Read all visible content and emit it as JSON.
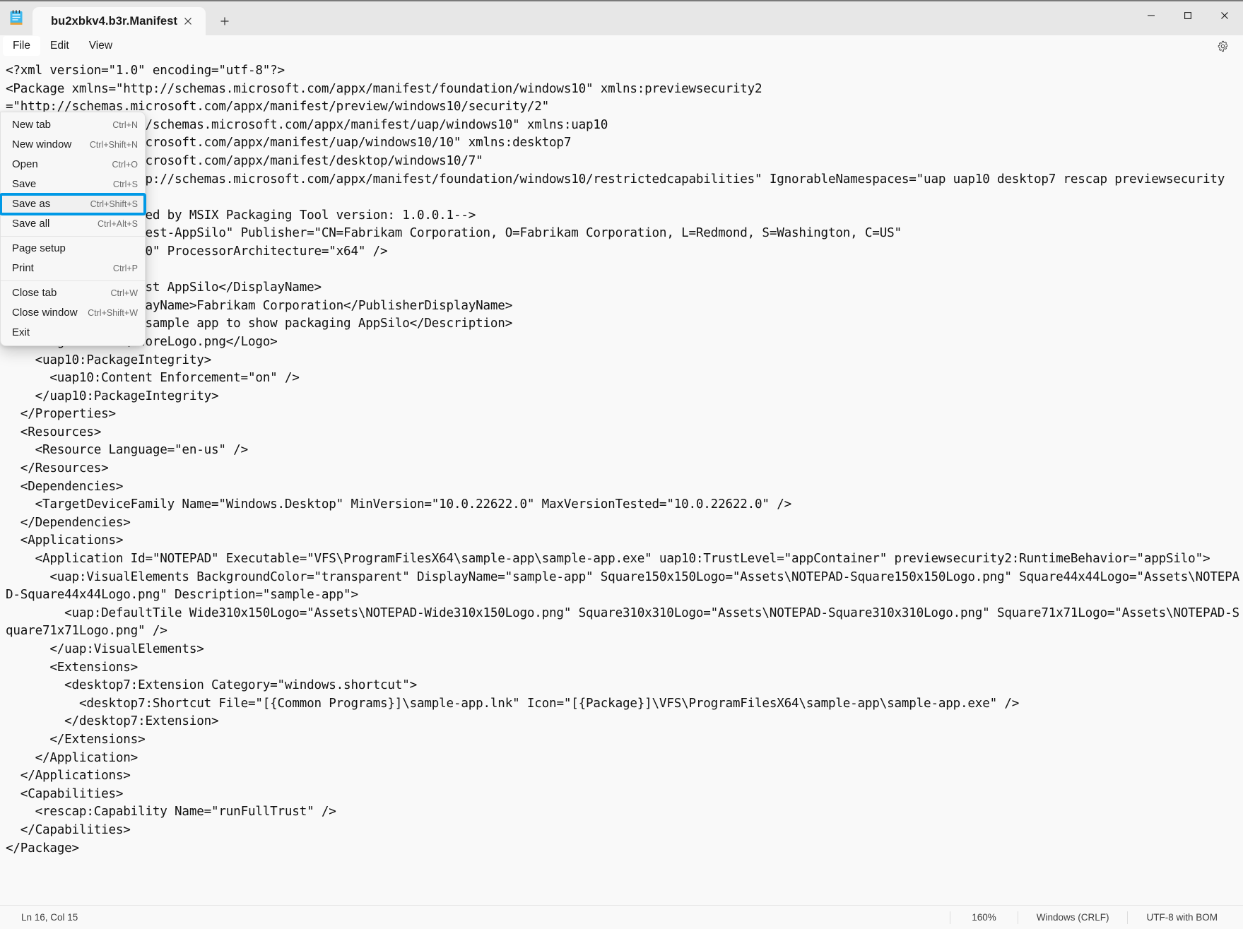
{
  "window": {
    "app_icon": "notepad-icon",
    "minimize_label": "─",
    "maximize_label": "□",
    "close_label": "✕"
  },
  "tabs": {
    "items": [
      {
        "label": "bu2xbkv4.b3r.Manifest",
        "close_label": "✕"
      }
    ],
    "new_tab_label": "+"
  },
  "menubar": {
    "items": [
      {
        "label": "File"
      },
      {
        "label": "Edit"
      },
      {
        "label": "View"
      }
    ],
    "settings_icon": "gear-icon"
  },
  "file_menu": {
    "highlight_color": "#0099e6",
    "groups": [
      {
        "items": [
          {
            "label": "New tab",
            "accel": "Ctrl+N",
            "highlighted": false
          },
          {
            "label": "New window",
            "accel": "Ctrl+Shift+N",
            "highlighted": false
          },
          {
            "label": "Open",
            "accel": "Ctrl+O",
            "highlighted": false
          },
          {
            "label": "Save",
            "accel": "Ctrl+S",
            "highlighted": false
          },
          {
            "label": "Save as",
            "accel": "Ctrl+Shift+S",
            "highlighted": true
          },
          {
            "label": "Save all",
            "accel": "Ctrl+Alt+S",
            "highlighted": false
          }
        ]
      },
      {
        "items": [
          {
            "label": "Page setup",
            "accel": "",
            "highlighted": false
          },
          {
            "label": "Print",
            "accel": "Ctrl+P",
            "highlighted": false
          }
        ]
      },
      {
        "items": [
          {
            "label": "Close tab",
            "accel": "Ctrl+W",
            "highlighted": false
          },
          {
            "label": "Close window",
            "accel": "Ctrl+Shift+W",
            "highlighted": false
          },
          {
            "label": "Exit",
            "accel": "",
            "highlighted": false
          }
        ]
      }
    ]
  },
  "editor": {
    "content": "<?xml version=\"1.0\" encoding=\"utf-8\"?>\n<Package xmlns=\"http://schemas.microsoft.com/appx/manifest/foundation/windows10\" xmlns:previewsecurity2\n=\"http://schemas.microsoft.com/appx/manifest/preview/windows10/security/2\"\n  xmlns:uap=\"http://schemas.microsoft.com/appx/manifest/uap/windows10\" xmlns:uap10\n=\"http://schemas.microsoft.com/appx/manifest/uap/windows10/10\" xmlns:desktop7\n=\"http://schemas.microsoft.com/appx/manifest/desktop/windows10/7\"\n  xmlns:rescap=\"http://schemas.microsoft.com/appx/manifest/foundation/windows10/restrictedcapabilities\" IgnorableNamespaces=\"uap uap10 desktop7 rescap previewsecurity2\">\n  <!--Package created by MSIX Packaging Tool version: 1.0.0.1-->\n  <Identity Name=\"Test-AppSilo\" Publisher=\"CN=Fabrikam Corporation, O=Fabrikam Corporation, L=Redmond, S=Washington, C=US\"\n    Version=\"1.0.0.0\" ProcessorArchitecture=\"x64\" />\n  <Properties>\n    <DisplayName>Test AppSilo</DisplayName>\n    <PublisherDisplayName>Fabrikam Corporation</PublisherDisplayName>\n    <Description>A sample app to show packaging AppSilo</Description>\n    <Logo>Assets\\StoreLogo.png</Logo>\n    <uap10:PackageIntegrity>\n      <uap10:Content Enforcement=\"on\" />\n    </uap10:PackageIntegrity>\n  </Properties>\n  <Resources>\n    <Resource Language=\"en-us\" />\n  </Resources>\n  <Dependencies>\n    <TargetDeviceFamily Name=\"Windows.Desktop\" MinVersion=\"10.0.22622.0\" MaxVersionTested=\"10.0.22622.0\" />\n  </Dependencies>\n  <Applications>\n    <Application Id=\"NOTEPAD\" Executable=\"VFS\\ProgramFilesX64\\sample-app\\sample-app.exe\" uap10:TrustLevel=\"appContainer\" previewsecurity2:RuntimeBehavior=\"appSilo\">\n      <uap:VisualElements BackgroundColor=\"transparent\" DisplayName=\"sample-app\" Square150x150Logo=\"Assets\\NOTEPAD-Square150x150Logo.png\" Square44x44Logo=\"Assets\\NOTEPAD-Square44x44Logo.png\" Description=\"sample-app\">\n        <uap:DefaultTile Wide310x150Logo=\"Assets\\NOTEPAD-Wide310x150Logo.png\" Square310x310Logo=\"Assets\\NOTEPAD-Square310x310Logo.png\" Square71x71Logo=\"Assets\\NOTEPAD-Square71x71Logo.png\" />\n      </uap:VisualElements>\n      <Extensions>\n        <desktop7:Extension Category=\"windows.shortcut\">\n          <desktop7:Shortcut File=\"[{Common Programs}]\\sample-app.lnk\" Icon=\"[{Package}]\\VFS\\ProgramFilesX64\\sample-app\\sample-app.exe\" />\n        </desktop7:Extension>\n      </Extensions>\n    </Application>\n  </Applications>\n  <Capabilities>\n    <rescap:Capability Name=\"runFullTrust\" />\n  </Capabilities>\n</Package>"
  },
  "statusbar": {
    "cursor_position": "Ln 16, Col 15",
    "zoom": "160%",
    "line_ending": "Windows (CRLF)",
    "encoding": "UTF-8 with BOM"
  }
}
